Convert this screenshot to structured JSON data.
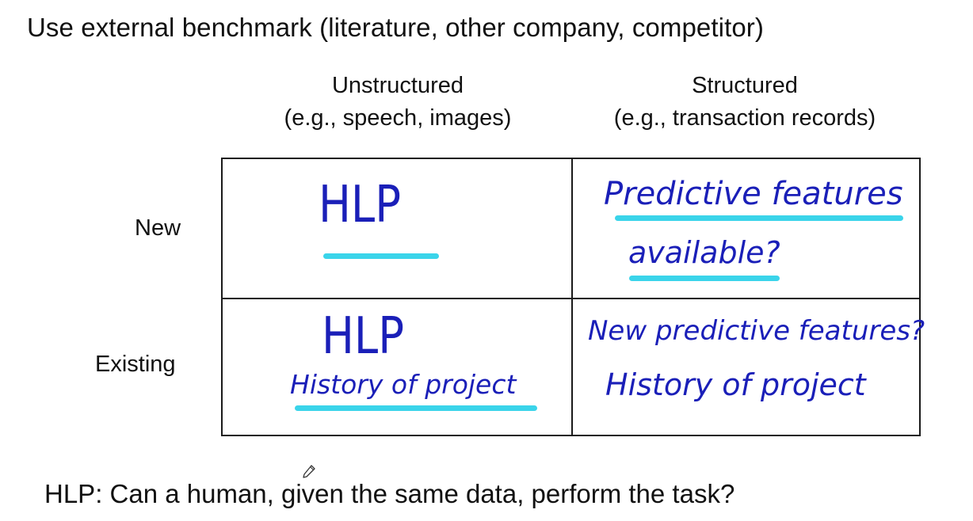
{
  "slide": {
    "title": "Use external benchmark (literature, other company, competitor)"
  },
  "columns": [
    {
      "heading": "Unstructured",
      "example": "(e.g., speech, images)"
    },
    {
      "heading": "Structured",
      "example": "(e.g., transaction records)"
    }
  ],
  "rows": [
    {
      "label": "New"
    },
    {
      "label": "Existing"
    }
  ],
  "cells": {
    "new_unstructured": {
      "text": "HLP"
    },
    "new_structured": {
      "line1": "Predictive features",
      "line2": "available?"
    },
    "existing_unstructured": {
      "line1": "HLP",
      "line2": "History of project"
    },
    "existing_structured": {
      "line1": "New predictive features?",
      "line2": "History of project"
    }
  },
  "footer": {
    "definition": "HLP: Can a human, given the same data, perform the task?"
  },
  "colors": {
    "ink": "#1a1fb8",
    "highlight": "#3ad4ea",
    "text": "#111111",
    "grid": "#1a1a1a"
  },
  "icons": {
    "cursor": "pen-cursor-icon"
  }
}
